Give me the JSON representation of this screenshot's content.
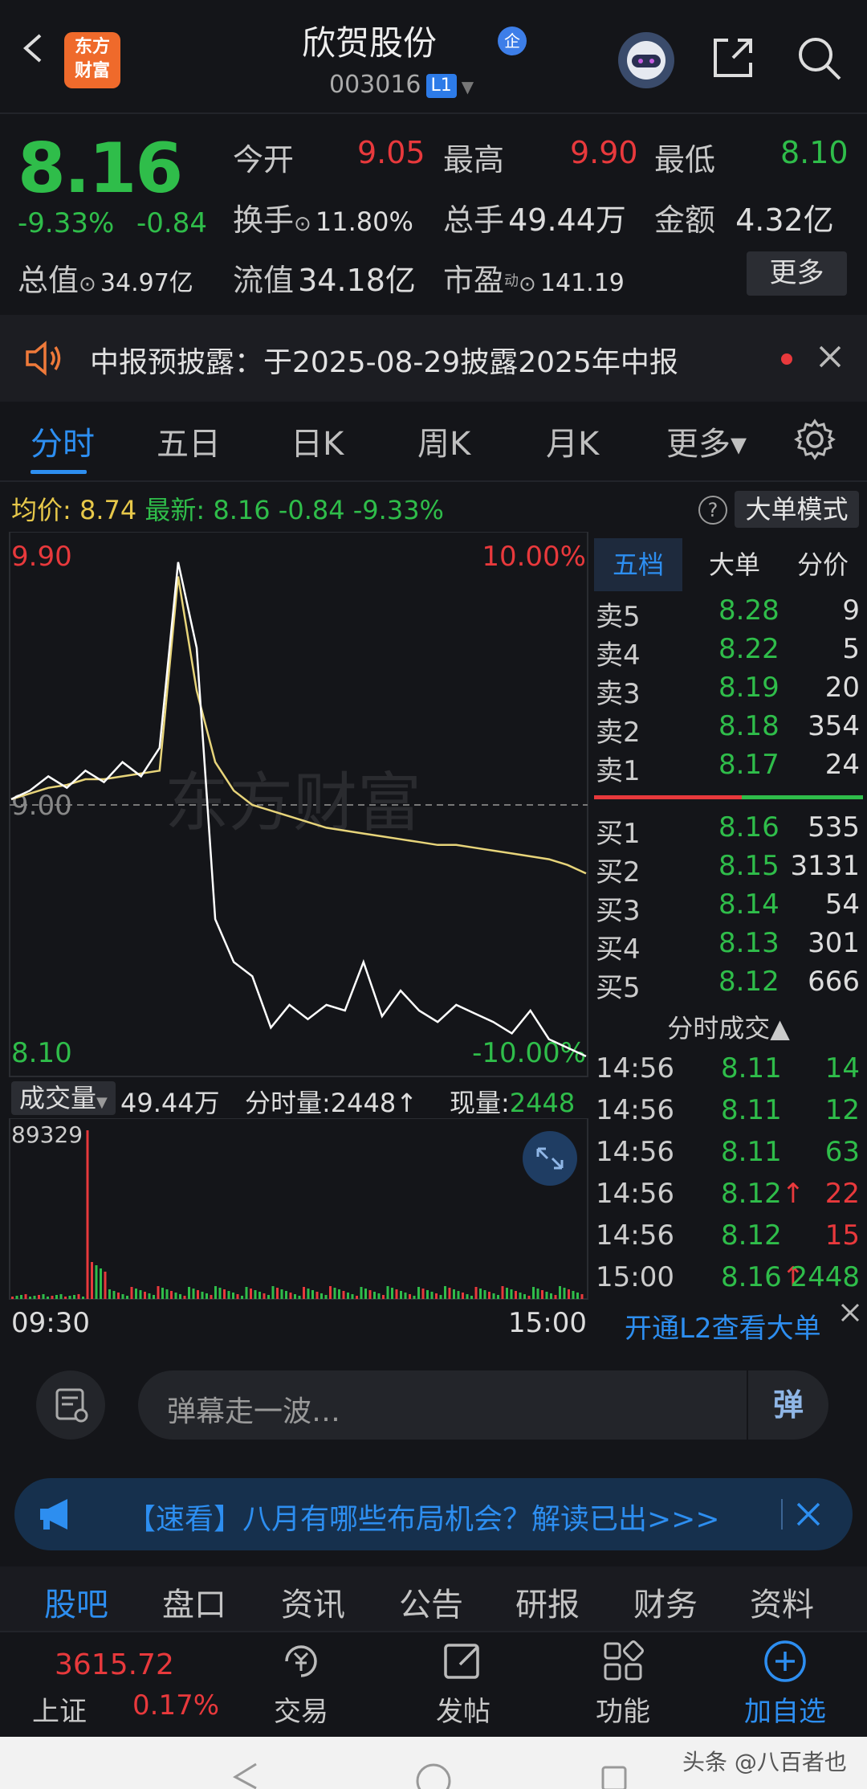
{
  "header": {
    "title": "欣贺股份",
    "badge": "企",
    "code": "003016",
    "level": "L1",
    "logo_line1": "东方",
    "logo_line2": "财富"
  },
  "quote": {
    "price": "8.16",
    "change_pct": "-9.33%",
    "change": "-0.84",
    "open_label": "今开",
    "open": "9.05",
    "high_label": "最高",
    "high": "9.90",
    "low_label": "最低",
    "low": "8.10",
    "turnover_label": "换手",
    "turnover": "11.80%",
    "volume_label": "总手",
    "volume": "49.44万",
    "amount_label": "金额",
    "amount": "4.32亿",
    "mktcap_label": "总值",
    "mktcap": "34.97亿",
    "float_label": "流值",
    "float": "34.18亿",
    "pe_label": "市盈",
    "pe_sup": "动",
    "pe": "141.19",
    "more": "更多"
  },
  "notice": {
    "text": "中报预披露：于2025-08-29披露2025年中报"
  },
  "tabs": [
    "分时",
    "五日",
    "日K",
    "周K",
    "月K",
    "更多▾"
  ],
  "infoline": {
    "avg_label": "均价:",
    "avg": "8.74",
    "latest_label": "最新:",
    "latest": "8.16",
    "chg": "-0.84",
    "pct": "-9.33%",
    "mode": "大单模式"
  },
  "chart_labels": {
    "top_price": "9.90",
    "top_pct": "10.00%",
    "mid_price": "9.00",
    "bottom_price": "8.10",
    "bottom_pct": "-10.00%",
    "watermark": "东方财富",
    "vol_label": "成交量",
    "vol_total": "49.44万",
    "fenshi_label": "分时量:",
    "fenshi": "2448↑",
    "now_label": "现量:",
    "now": "2448",
    "vol_max": "89329",
    "time_start": "09:30",
    "time_end": "15:00"
  },
  "chart_data": {
    "type": "line",
    "x": [
      "09:30",
      "15:00"
    ],
    "ylim": [
      8.1,
      9.9
    ],
    "series": [
      {
        "values": [
          9.02,
          9.05,
          9.1,
          9.06,
          9.12,
          9.08,
          9.15,
          9.1,
          9.2,
          9.85,
          9.55,
          8.6,
          8.45,
          8.4,
          8.22,
          8.3,
          8.25,
          8.3,
          8.28,
          8.45,
          8.26,
          8.35,
          8.28,
          8.24,
          8.3,
          8.27,
          8.24,
          8.2,
          8.28,
          8.18,
          8.15,
          8.12
        ]
      },
      {
        "values": [
          9.02,
          9.04,
          9.06,
          9.07,
          9.09,
          9.09,
          9.1,
          9.11,
          9.12,
          9.8,
          9.4,
          9.15,
          9.05,
          9.0,
          8.98,
          8.96,
          8.94,
          8.92,
          8.91,
          8.9,
          8.89,
          8.88,
          8.87,
          8.86,
          8.86,
          8.85,
          8.84,
          8.83,
          8.82,
          8.81,
          8.79,
          8.76
        ]
      }
    ]
  },
  "orderbook": {
    "tabs": [
      "五档",
      "大单",
      "分价"
    ],
    "asks": [
      {
        "label": "卖5",
        "price": "8.28",
        "qty": "9"
      },
      {
        "label": "卖4",
        "price": "8.22",
        "qty": "5"
      },
      {
        "label": "卖3",
        "price": "8.19",
        "qty": "20"
      },
      {
        "label": "卖2",
        "price": "8.18",
        "qty": "354"
      },
      {
        "label": "卖1",
        "price": "8.17",
        "qty": "24"
      }
    ],
    "bids": [
      {
        "label": "买1",
        "price": "8.16",
        "qty": "535"
      },
      {
        "label": "买2",
        "price": "8.15",
        "qty": "3131"
      },
      {
        "label": "买3",
        "price": "8.14",
        "qty": "54"
      },
      {
        "label": "买4",
        "price": "8.13",
        "qty": "301"
      },
      {
        "label": "买5",
        "price": "8.12",
        "qty": "666"
      }
    ],
    "trades_title": "分时成交▲",
    "trades": [
      {
        "time": "14:56",
        "price": "8.11",
        "qty": "14",
        "color": "green"
      },
      {
        "time": "14:56",
        "price": "8.11",
        "qty": "12",
        "color": "green"
      },
      {
        "time": "14:56",
        "price": "8.11",
        "qty": "63",
        "color": "green"
      },
      {
        "time": "14:56",
        "price": "8.12↑",
        "qty": "22",
        "color": "red"
      },
      {
        "time": "14:56",
        "price": "8.12",
        "qty": "15",
        "color": "red"
      },
      {
        "time": "15:00",
        "price": "8.16↑",
        "qty": "2448",
        "color": "green"
      }
    ],
    "l2": "开通L2查看大单"
  },
  "danmu": {
    "placeholder": "弹幕走一波…",
    "send": "弹"
  },
  "promo": {
    "text": "【速看】八月有哪些布局机会？解读已出>>>"
  },
  "bottom_tabs": [
    "股吧",
    "盘口",
    "资讯",
    "公告",
    "研报",
    "财务",
    "资料"
  ],
  "nav": {
    "index_value": "3615.72",
    "index_name": "上证",
    "index_pct": "0.17%",
    "trade": "交易",
    "post": "发帖",
    "func": "功能",
    "add": "加自选"
  },
  "watermark_footer": "头条 @八百者也",
  "colors": {
    "up": "#e8393c",
    "down": "#2fbd4a",
    "accent": "#2d8ef0",
    "avg_line": "#e7d47a"
  }
}
